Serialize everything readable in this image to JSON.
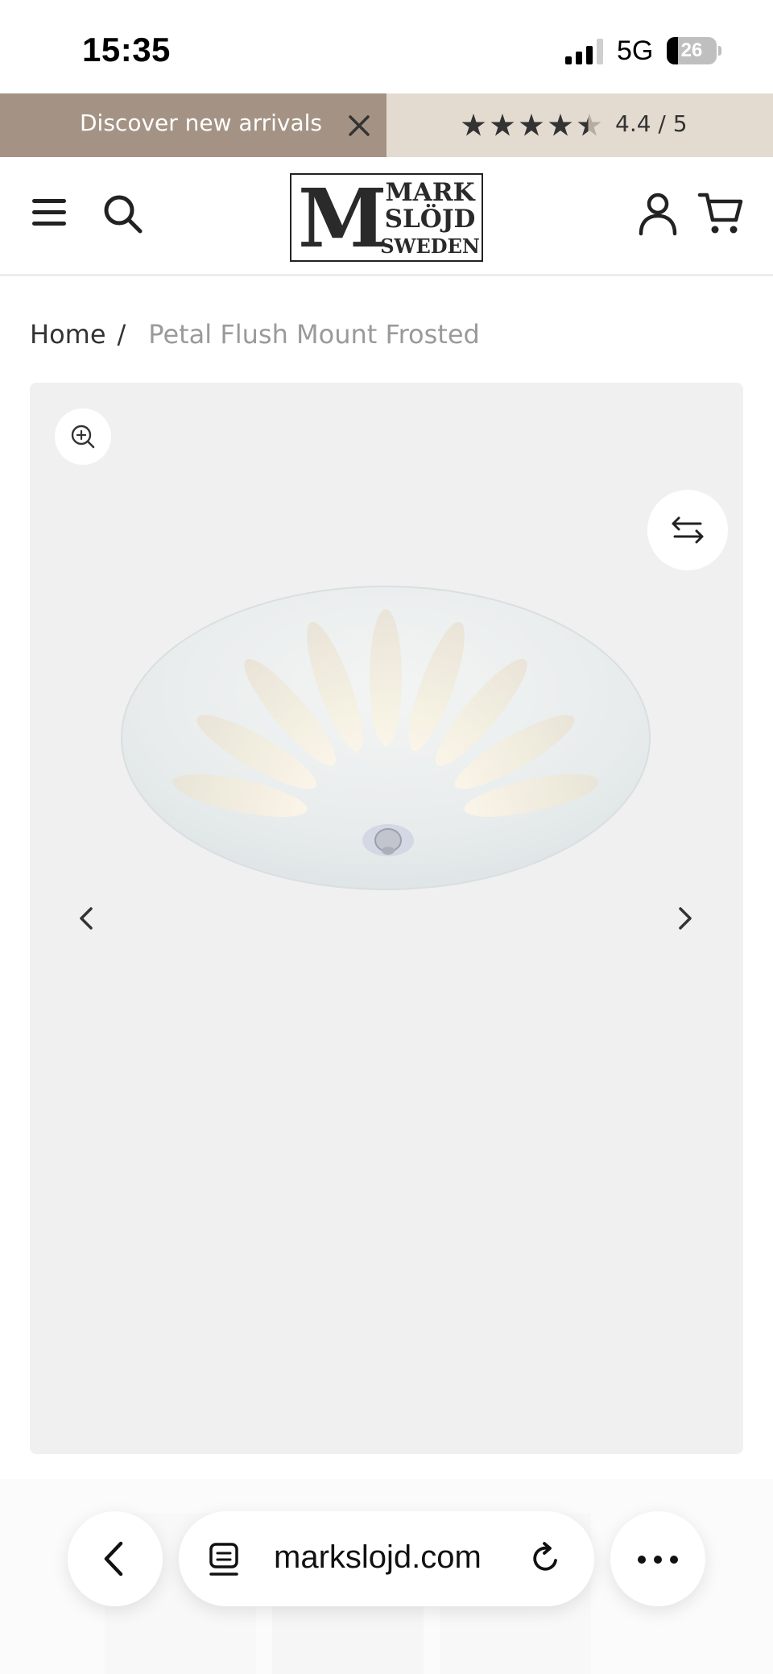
{
  "status_bar": {
    "time": "15:35",
    "network": "5G",
    "battery": "26"
  },
  "announcement": {
    "text": "Discover new arrivals",
    "rating_stars": 4.4,
    "rating_text": "4.4 / 5"
  },
  "header": {
    "logo": {
      "letter": "M",
      "line1": "MARK",
      "line2": "SLÖJD",
      "line3": "SWEDEN"
    }
  },
  "breadcrumb": {
    "home": "Home",
    "separator": "/",
    "current": "Petal Flush Mount Frosted"
  },
  "browser": {
    "url": "markslojd.com"
  },
  "colors": {
    "announce_left_bg": "#a49384",
    "announce_right_bg": "#e4dbd0",
    "gallery_bg": "#f0f0f0"
  },
  "icons": [
    "close-icon",
    "star-icon",
    "menu-icon",
    "search-icon",
    "account-icon",
    "cart-icon",
    "zoom-in-icon",
    "swap-arrows-icon",
    "chevron-left-icon",
    "chevron-right-icon",
    "tabs-icon",
    "reload-icon",
    "more-icon"
  ]
}
